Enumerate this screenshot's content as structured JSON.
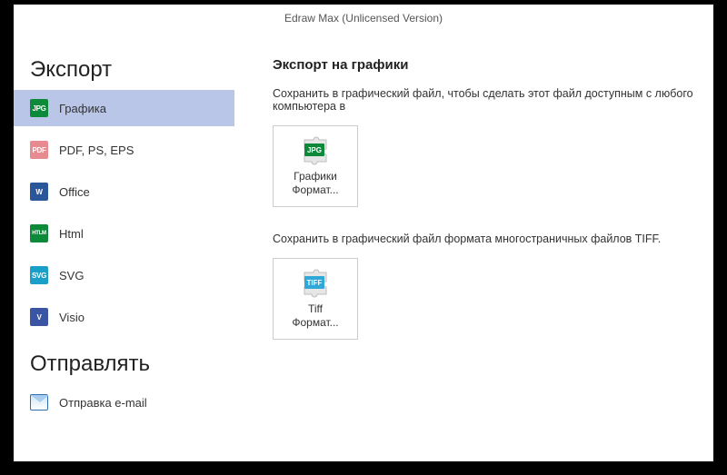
{
  "titlebar": "Edraw Max (Unlicensed Version)",
  "sidebar": {
    "export_title": "Экспорт",
    "items": [
      {
        "label": "Графика"
      },
      {
        "label": "PDF, PS, EPS"
      },
      {
        "label": "Office"
      },
      {
        "label": "Html"
      },
      {
        "label": "SVG"
      },
      {
        "label": "Visio"
      }
    ],
    "send_title": "Отправлять",
    "send_items": [
      {
        "label": "Отправка e-mail"
      }
    ]
  },
  "content": {
    "title": "Экспорт на графики",
    "desc1": "Сохранить в графический файл, чтобы сделать этот файл доступным с любого компьютера в",
    "tile1_line1": "Графики",
    "tile1_line2": "Формат...",
    "desc2": "Сохранить в графический файл формата многостраничных файлов TIFF.",
    "tile2_line1": "Tiff",
    "tile2_line2": "Формат..."
  },
  "icons": {
    "jpg": "JPG",
    "pdf": "PDF",
    "word": "W",
    "html": "HTLM",
    "svg": "SVG",
    "visio": "V",
    "tiff": "TIFF"
  }
}
